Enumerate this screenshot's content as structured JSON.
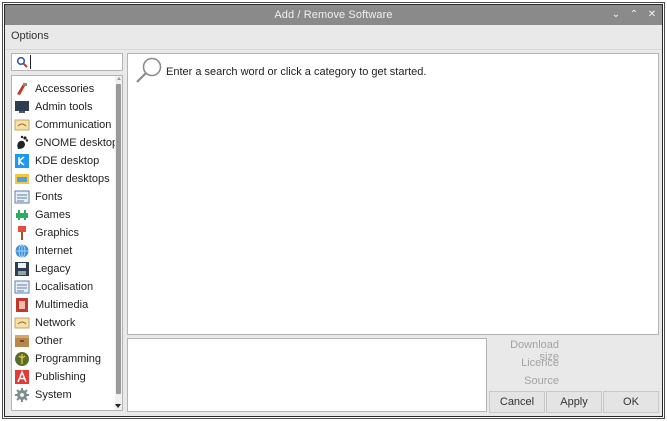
{
  "window": {
    "title": "Add / Remove Software",
    "controls": {
      "minimize": "⌄",
      "maximize": "⌃",
      "close": "✕"
    }
  },
  "menubar": {
    "options": "Options"
  },
  "search": {
    "value": "",
    "placeholder": ""
  },
  "categories": [
    {
      "label": "Accessories",
      "icon": "accessories-icon"
    },
    {
      "label": "Admin tools",
      "icon": "admin-tools-icon"
    },
    {
      "label": "Communication",
      "icon": "communication-icon"
    },
    {
      "label": "GNOME desktop",
      "icon": "gnome-icon"
    },
    {
      "label": "KDE desktop",
      "icon": "kde-icon"
    },
    {
      "label": "Other desktops",
      "icon": "other-desktops-icon"
    },
    {
      "label": "Fonts",
      "icon": "fonts-icon"
    },
    {
      "label": "Games",
      "icon": "games-icon"
    },
    {
      "label": "Graphics",
      "icon": "graphics-icon"
    },
    {
      "label": "Internet",
      "icon": "internet-icon"
    },
    {
      "label": "Legacy",
      "icon": "legacy-icon"
    },
    {
      "label": "Localisation",
      "icon": "localisation-icon"
    },
    {
      "label": "Multimedia",
      "icon": "multimedia-icon"
    },
    {
      "label": "Network",
      "icon": "network-icon"
    },
    {
      "label": "Other",
      "icon": "other-icon"
    },
    {
      "label": "Programming",
      "icon": "programming-icon"
    },
    {
      "label": "Publishing",
      "icon": "publishing-icon"
    },
    {
      "label": "System",
      "icon": "system-icon"
    }
  ],
  "main": {
    "hint": "Enter a search word or click a category to get started."
  },
  "details": {
    "download_size": "Download size",
    "licence": "Licence",
    "source": "Source"
  },
  "buttons": {
    "cancel": "Cancel",
    "apply": "Apply",
    "ok": "OK"
  },
  "colors": {
    "titlebar": "#8a8a8a",
    "window_bg": "#e9e9e9",
    "info_text": "#a3a3a3"
  }
}
